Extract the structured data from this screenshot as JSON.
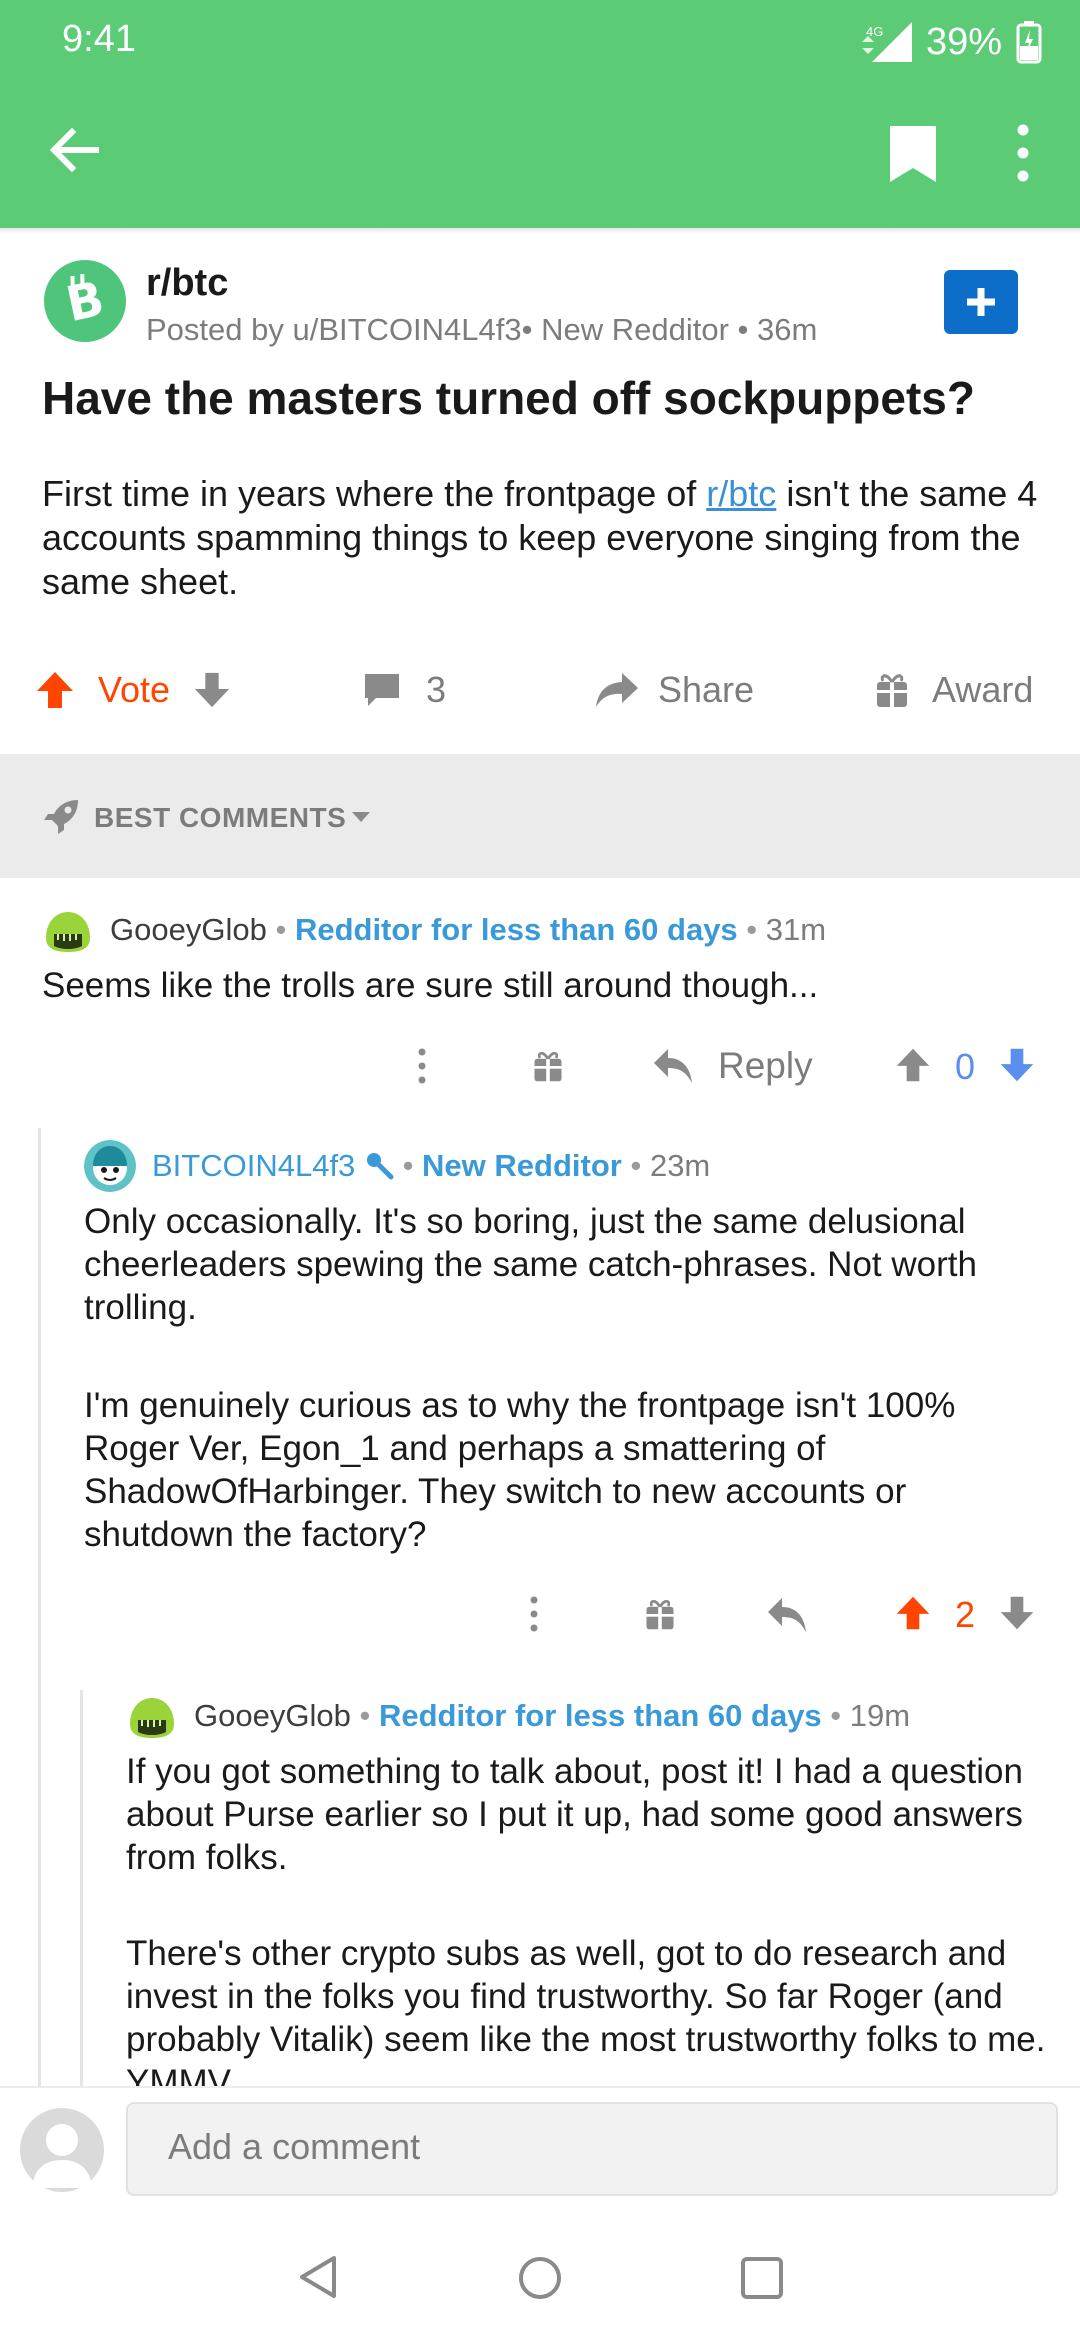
{
  "status_bar": {
    "time": "9:41",
    "network": "4G",
    "battery": "39%"
  },
  "app_bar": {
    "back_icon": "arrow-left-icon",
    "bookmark_icon": "bookmark-icon",
    "more_icon": "more-vert-icon"
  },
  "post": {
    "subreddit": "r/btc",
    "meta": "Posted by u/BITCOIN4L4f3• New Redditor • 36m",
    "title": "Have the masters turned off sockpuppets?",
    "body_before_link": "First time in years where the frontpage of ",
    "body_link": "r/btc",
    "body_after_link": " isn't the same 4 accounts spamming things to keep everyone singing from the same sheet.",
    "actions": {
      "vote": "Vote",
      "comments": "3",
      "share": "Share",
      "award": "Award"
    }
  },
  "sort": {
    "label": "BEST COMMENTS"
  },
  "comments": [
    {
      "author": "GooeyGlob",
      "flair": "Redditor for less than 60 days",
      "time": "31m",
      "paragraphs": [
        "Seems like the trolls are sure still around though..."
      ],
      "reply_label": "Reply",
      "score": "0"
    },
    {
      "author": "BITCOIN4L4f3",
      "flair": "New Redditor",
      "time": "23m",
      "paragraphs": [
        "Only occasionally. It's so boring, just the same delusional cheerleaders spewing the same catch-phrases. Not worth trolling.",
        "I'm genuinely curious as to why the frontpage isn't 100% Roger Ver, Egon_1 and perhaps a smattering of ShadowOfHarbinger. They switch to new accounts or shutdown the factory?"
      ],
      "score": "2"
    },
    {
      "author": "GooeyGlob",
      "flair": "Redditor for less than 60 days",
      "time": "19m",
      "paragraphs": [
        "If you got something to talk about, post it! I had a question about Purse earlier so I put it up, had some good answers from folks.",
        "There's other crypto subs as well, got to do research and invest in the folks you find trustworthy. So far Roger (and probably Vitalik) seem like the most trustworthy folks to me. YMMV"
      ]
    }
  ],
  "compose": {
    "placeholder": "Add a comment"
  },
  "colors": {
    "header": "#5ccb76",
    "upvote": "#ff4500",
    "downvote": "#5a8ff0",
    "link": "#3a9ad9",
    "join": "#0c6ec8"
  }
}
